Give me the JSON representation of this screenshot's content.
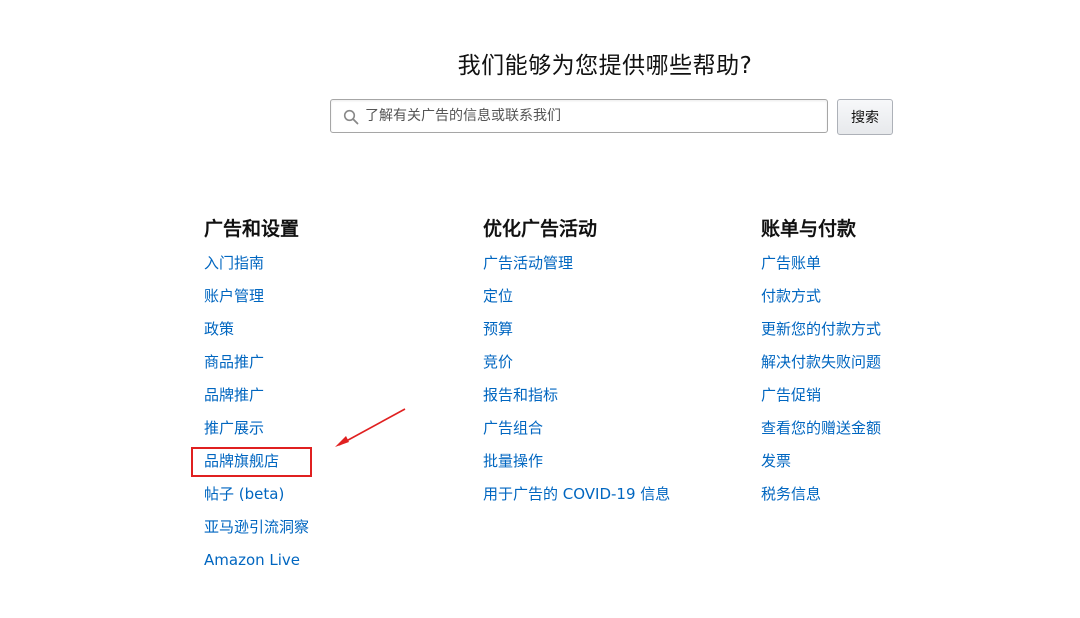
{
  "header": {
    "title": "我们能够为您提供哪些帮助?"
  },
  "search": {
    "placeholder": "了解有关广告的信息或联系我们",
    "value": "",
    "button_label": "搜索"
  },
  "columns": [
    {
      "heading": "广告和设置",
      "links": [
        "入门指南",
        "账户管理",
        "政策",
        "商品推广",
        "品牌推广",
        "推广展示",
        "品牌旗舰店",
        "帖子 (beta)",
        "亚马逊引流洞察",
        "Amazon Live"
      ]
    },
    {
      "heading": "优化广告活动",
      "links": [
        "广告活动管理",
        "定位",
        "预算",
        "竞价",
        "报告和指标",
        "广告组合",
        "批量操作",
        "用于广告的 COVID-19 信息"
      ]
    },
    {
      "heading": "账单与付款",
      "links": [
        "广告账单",
        "付款方式",
        "更新您的付款方式",
        "解决付款失败问题",
        "广告促销",
        "查看您的赠送金额",
        "发票",
        "税务信息"
      ]
    }
  ],
  "colors": {
    "link": "#0066c0",
    "annotation": "#e02020"
  },
  "icons": {
    "search": "search-icon"
  }
}
